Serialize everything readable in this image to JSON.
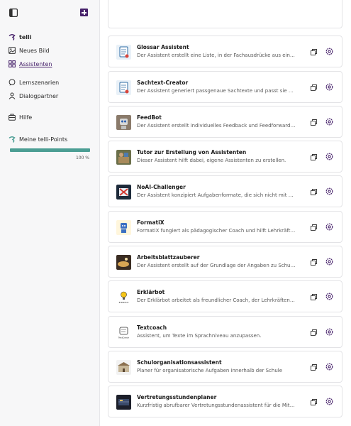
{
  "sidebar": {
    "toggle_icon": "sidebar-toggle-icon",
    "new_icon": "plus-square-icon",
    "items": [
      {
        "id": "telli",
        "label": "telli",
        "icon": "telli-logo-icon"
      },
      {
        "id": "neues-bild",
        "label": "Neues Bild",
        "icon": "image-icon"
      },
      {
        "id": "assistenten",
        "label": "Assistenten",
        "icon": "grid-icon"
      },
      {
        "id": "lernszenarien",
        "label": "Lernszenarien",
        "icon": "chat-bubble-icon"
      },
      {
        "id": "dialogpartner",
        "label": "Dialogpartner",
        "icon": "people-icon"
      },
      {
        "id": "hilfe",
        "label": "Hilfe",
        "icon": "help-icon"
      }
    ],
    "points": {
      "label": "Meine telli-Points",
      "percent_text": "100 %",
      "fill_fraction": 1.0,
      "color": "#4c9e94"
    }
  },
  "header": {
    "user_icon": "user-profile-icon"
  },
  "colors": {
    "accent": "#46216a",
    "progress": "#4c9e94"
  },
  "assistants": [
    {
      "title": "Glossar Assistent",
      "desc": "Der Assistent erstellt eine Liste, in der Fachausdrücke aus einem …",
      "thumb": "doc-icon"
    },
    {
      "title": "Sachtext-Creator",
      "desc": "Der Assistent generiert passgenaue Sachtexte und passt sie unte…",
      "thumb": "doc-icon"
    },
    {
      "title": "FeedBot",
      "desc": "Der Assistent erstellt individuelles Feedback und Feedforward, au…",
      "thumb": "robot-photo"
    },
    {
      "title": "Tutor zur Erstellung von Assistenten",
      "desc": "Dieser Assistent hilft dabei, eigene Assistenten zu erstellen.",
      "thumb": "tutor-photo"
    },
    {
      "title": "NoAI-Challenger",
      "desc": "Der Assistent konzipiert Aufgabenformate, die sich nicht mit dem …",
      "thumb": "no-ai-icon"
    },
    {
      "title": "FormatiX",
      "desc": "FormatiX fungiert als pädagogischer Coach und hilft Lehrkräften …",
      "thumb": "formatix-icon"
    },
    {
      "title": "Arbeitsblattzauberer",
      "desc": "Der Assistent erstellt auf der Grundlage der Angaben zu Schulfor…",
      "thumb": "magic-photo"
    },
    {
      "title": "Erklärbot",
      "desc": "Der Erklärbot arbeitet als freundlicher Coach, der Lehrkräften dab…",
      "thumb": "lightbulb-icon"
    },
    {
      "title": "Textcoach",
      "desc": "Assistent, um Texte im Sprachniveau anzupassen.",
      "thumb": "textcoach-icon"
    },
    {
      "title": "Schulorganisationsassistent",
      "desc": "Planer für organisatorische Aufgaben innerhalb der Schule",
      "thumb": "school-icon"
    },
    {
      "title": "Vertretungsstundenplaner",
      "desc": "Kurzfristig abrufbarer Vertretungsstundenassistent für die Mittel…",
      "thumb": "schedule-photo"
    }
  ],
  "thumb_labels": {
    "erklaerbot": "Erklärbot",
    "textcoach": "TextCoach"
  },
  "card_icons": {
    "copy": "copy-icon",
    "settings": "gear-icon"
  }
}
